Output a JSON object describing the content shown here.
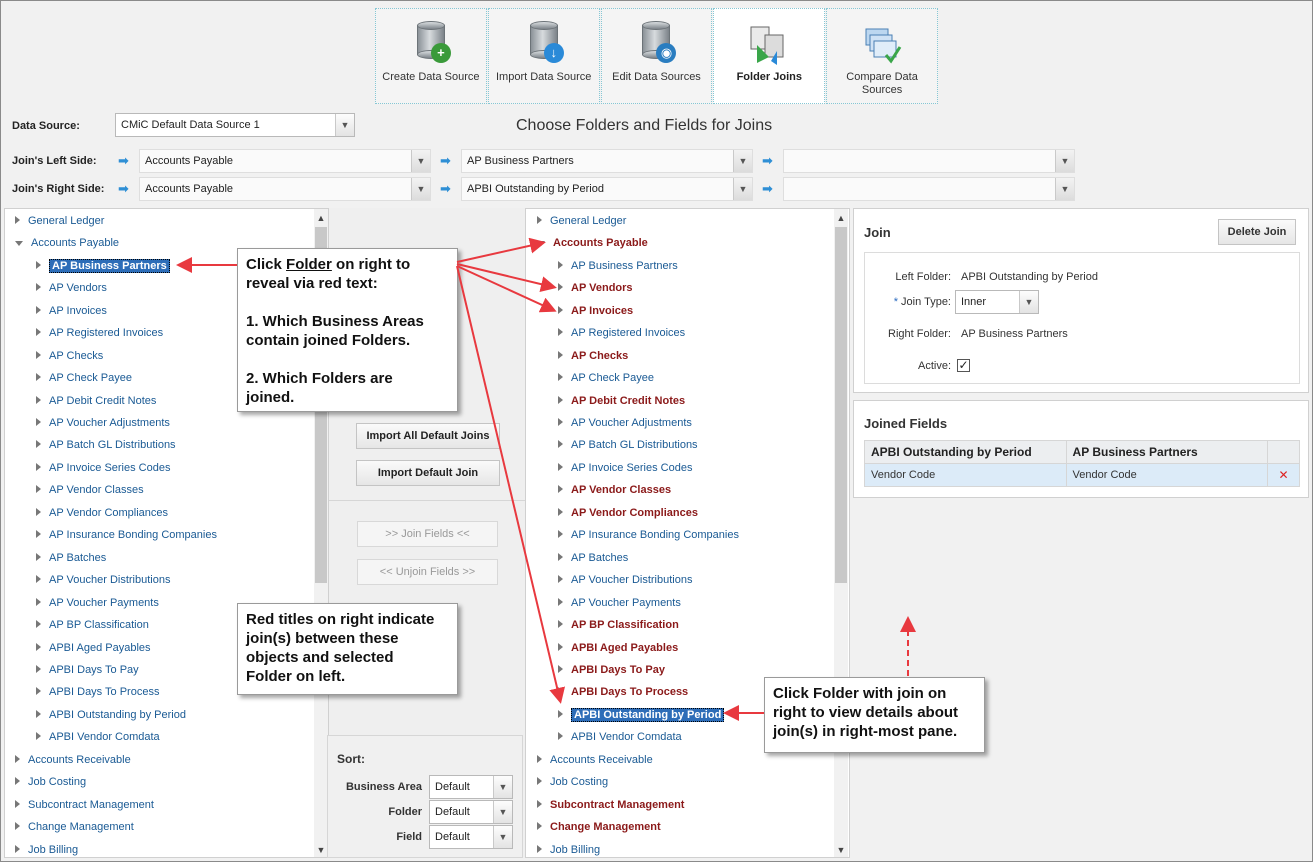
{
  "toolbar": {
    "items": [
      {
        "label": "Create Data Source",
        "icon": "database-add-icon"
      },
      {
        "label": "Import Data Source",
        "icon": "database-import-icon"
      },
      {
        "label": "Edit Data Sources",
        "icon": "database-edit-icon"
      },
      {
        "label": "Folder Joins",
        "icon": "folder-joins-icon",
        "active": true
      },
      {
        "label": "Compare Data Sources",
        "icon": "compare-sources-icon"
      }
    ]
  },
  "data_source": {
    "label": "Data Source:",
    "value": "CMiC Default Data Source 1"
  },
  "page_title": "Choose Folders and Fields for Joins",
  "join_left": {
    "label": "Join's Left Side:",
    "area": "Accounts Payable",
    "folder": "AP Business Partners",
    "field": ""
  },
  "join_right": {
    "label": "Join's Right Side:",
    "area": "Accounts Payable",
    "folder": "APBI Outstanding by Period",
    "field": ""
  },
  "left_tree": {
    "top": [
      "General Ledger",
      "Accounts Payable"
    ],
    "children": [
      "AP Business Partners",
      "AP Vendors",
      "AP Invoices",
      "AP Registered Invoices",
      "AP Checks",
      "AP Check Payee",
      "AP Debit Credit Notes",
      "AP Voucher Adjustments",
      "AP Batch GL Distributions",
      "AP Invoice Series Codes",
      "AP Vendor Classes",
      "AP Vendor Compliances",
      "AP Insurance Bonding Companies",
      "AP Batches",
      "AP Voucher Distributions",
      "AP Voucher Payments",
      "AP BP Classification",
      "APBI Aged Payables",
      "APBI Days To Pay",
      "APBI Days To Process",
      "APBI Outstanding by Period",
      "APBI Vendor Comdata"
    ],
    "bottom": [
      "Accounts Receivable",
      "Job Costing",
      "Subcontract Management",
      "Change Management",
      "Job Billing"
    ]
  },
  "right_tree": {
    "top": [
      "General Ledger",
      "Accounts Payable"
    ],
    "children": [
      "AP Business Partners",
      "AP Vendors",
      "AP Invoices",
      "AP Registered Invoices",
      "AP Checks",
      "AP Check Payee",
      "AP Debit Credit Notes",
      "AP Voucher Adjustments",
      "AP Batch GL Distributions",
      "AP Invoice Series Codes",
      "AP Vendor Classes",
      "AP Vendor Compliances",
      "AP Insurance Bonding Companies",
      "AP Batches",
      "AP Voucher Distributions",
      "AP Voucher Payments",
      "AP BP Classification",
      "APBI Aged Payables",
      "APBI Days To Pay",
      "APBI Days To Process",
      "APBI Outstanding by Period",
      "APBI Vendor Comdata"
    ],
    "bottom": [
      "Accounts Receivable",
      "Job Costing",
      "Subcontract Management",
      "Change Management",
      "Job Billing"
    ]
  },
  "middle": {
    "import_all": "Import All Default Joins",
    "import_one": "Import Default Join",
    "join_fields": ">>  Join Fields  <<",
    "unjoin_fields": "<< Unjoin Fields >>",
    "sort_title": "Sort:",
    "sort_business_area_label": "Business Area",
    "sort_business_area": "Default",
    "sort_folder_label": "Folder",
    "sort_folder": "Default",
    "sort_field_label": "Field",
    "sort_field": "Default"
  },
  "join_panel": {
    "title": "Join",
    "delete": "Delete Join",
    "left_folder_label": "Left Folder:",
    "left_folder": "APBI Outstanding by Period",
    "join_type_label": "Join Type:",
    "join_type_required": "*",
    "join_type": "Inner",
    "right_folder_label": "Right Folder:",
    "right_folder": "AP Business Partners",
    "active_label": "Active:",
    "active_mark": "✓"
  },
  "joined_fields": {
    "title": "Joined Fields",
    "col1": "APBI Outstanding by Period",
    "col2": "AP Business Partners",
    "rows": [
      {
        "left": "Vendor Code",
        "right": "Vendor Code"
      }
    ],
    "delete_mark": "✕"
  },
  "callouts": {
    "c1_line1": "Click ",
    "c1_folder": "Folder",
    "c1_line1b": " on right to",
    "c1_line2": "reveal via red text:",
    "c1_line3": "1. Which Business Areas",
    "c1_line4": "contain joined Folders.",
    "c1_line5": "2. Which Folders are",
    "c1_line6": "joined.",
    "c2_line1": "Red titles on right indicate",
    "c2_line2": "join(s) between these",
    "c2_line3": "objects and selected",
    "c2_line4": "Folder on left.",
    "c3_line1": "Click Folder with join on",
    "c3_line2": "right to view details about",
    "c3_line3": "join(s) in right-most pane."
  },
  "colors": {
    "link": "#1a5a94",
    "joined": "#8b1a1a",
    "annotation_arrow": "#e8393f"
  }
}
